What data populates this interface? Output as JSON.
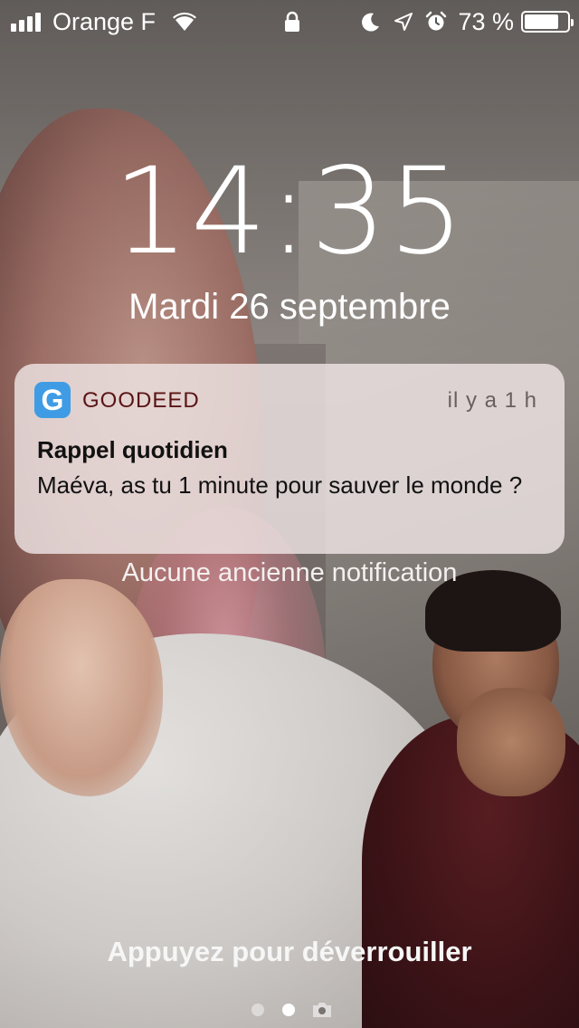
{
  "status_bar": {
    "carrier": "Orange F",
    "signal_bars": 4,
    "battery_percent": "73 %",
    "battery_level": 0.73,
    "icons": [
      "signal-icon",
      "wifi-icon",
      "lock-icon",
      "moon-icon",
      "location-icon",
      "alarm-icon",
      "battery-icon"
    ]
  },
  "lock_screen": {
    "time": "14:35",
    "date": "Mardi 26 septembre"
  },
  "notification": {
    "app_icon_letter": "G",
    "app_name": "GOODEED",
    "time_ago": "il y a 1 h",
    "title": "Rappel quotidien",
    "body": "Maéva, as tu 1 minute pour sauver le monde ?",
    "accent_color": "#3f9ce4"
  },
  "no_older_notifications": "Aucune ancienne notification",
  "unlock_hint": "Appuyez pour déverrouiller",
  "pager": {
    "pages": 2,
    "active_page": 2,
    "trailing_icon": "camera-icon"
  }
}
